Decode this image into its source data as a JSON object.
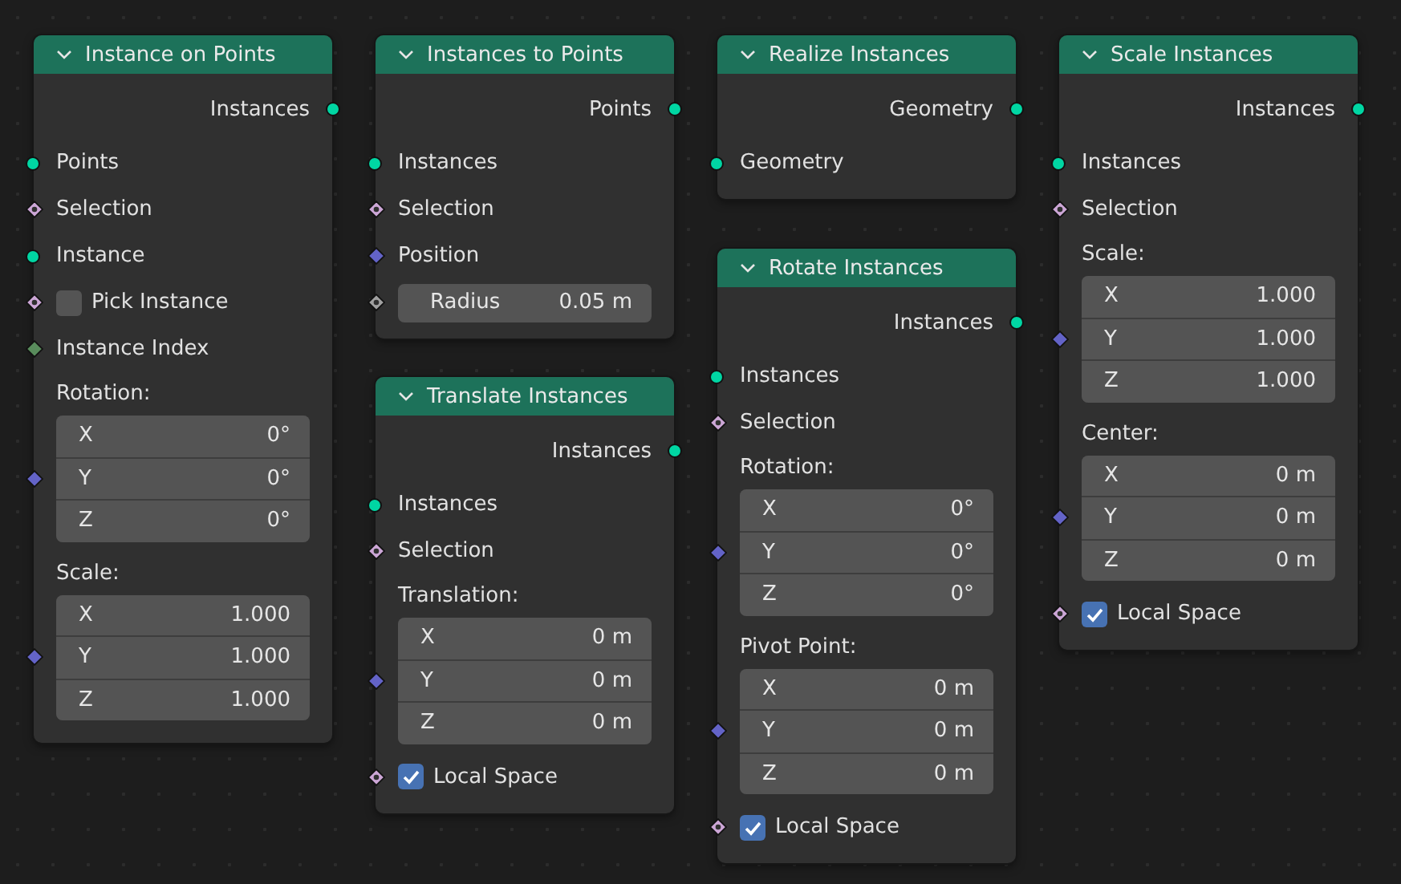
{
  "nodes": [
    {
      "title": "Instance on Points",
      "rows": [
        {
          "kind": "output",
          "label": "Instances",
          "socket": {
            "kind": "geometry"
          }
        },
        {
          "kind": "input",
          "label": "Points",
          "socket": {
            "kind": "geometry"
          }
        },
        {
          "kind": "input",
          "label": "Selection",
          "socket": {
            "kind": "bool"
          }
        },
        {
          "kind": "input",
          "label": "Instance",
          "socket": {
            "kind": "geometry"
          }
        },
        {
          "kind": "checkbox",
          "label": "Pick Instance",
          "socket": {
            "kind": "bool"
          },
          "checked": false
        },
        {
          "kind": "input",
          "label": "Instance Index",
          "socket": {
            "kind": "int"
          }
        },
        {
          "kind": "vector",
          "label": "Rotation:",
          "socket": {
            "kind": "vector"
          },
          "values": [
            {
              "axis": "X",
              "value": "0°"
            },
            {
              "axis": "Y",
              "value": "0°"
            },
            {
              "axis": "Z",
              "value": "0°"
            }
          ]
        },
        {
          "kind": "vector",
          "label": "Scale:",
          "socket": {
            "kind": "vector"
          },
          "values": [
            {
              "axis": "X",
              "value": "1.000"
            },
            {
              "axis": "Y",
              "value": "1.000"
            },
            {
              "axis": "Z",
              "value": "1.000"
            }
          ]
        }
      ]
    },
    {
      "title": "Instances to Points",
      "rows": [
        {
          "kind": "output",
          "label": "Points",
          "socket": {
            "kind": "geometry"
          }
        },
        {
          "kind": "input",
          "label": "Instances",
          "socket": {
            "kind": "geometry"
          }
        },
        {
          "kind": "input",
          "label": "Selection",
          "socket": {
            "kind": "bool"
          }
        },
        {
          "kind": "input",
          "label": "Position",
          "socket": {
            "kind": "vector"
          }
        },
        {
          "kind": "value",
          "label": "Radius",
          "value": "0.05 m",
          "socket": {
            "kind": "float"
          }
        }
      ]
    },
    {
      "title": "Realize Instances",
      "rows": [
        {
          "kind": "output",
          "label": "Geometry",
          "socket": {
            "kind": "geometry"
          }
        },
        {
          "kind": "input",
          "label": "Geometry",
          "socket": {
            "kind": "geometry"
          }
        }
      ]
    },
    {
      "title": "Scale Instances",
      "rows": [
        {
          "kind": "output",
          "label": "Instances",
          "socket": {
            "kind": "geometry"
          }
        },
        {
          "kind": "input",
          "label": "Instances",
          "socket": {
            "kind": "geometry"
          }
        },
        {
          "kind": "input",
          "label": "Selection",
          "socket": {
            "kind": "bool"
          }
        },
        {
          "kind": "vector",
          "label": "Scale:",
          "socket": {
            "kind": "vector"
          },
          "values": [
            {
              "axis": "X",
              "value": "1.000"
            },
            {
              "axis": "Y",
              "value": "1.000"
            },
            {
              "axis": "Z",
              "value": "1.000"
            }
          ]
        },
        {
          "kind": "vector",
          "label": "Center:",
          "socket": {
            "kind": "vector"
          },
          "values": [
            {
              "axis": "X",
              "value": "0 m"
            },
            {
              "axis": "Y",
              "value": "0 m"
            },
            {
              "axis": "Z",
              "value": "0 m"
            }
          ]
        },
        {
          "kind": "checkbox",
          "label": "Local Space",
          "socket": {
            "kind": "bool"
          },
          "checked": true
        }
      ]
    },
    {
      "title": "Translate Instances",
      "rows": [
        {
          "kind": "output",
          "label": "Instances",
          "socket": {
            "kind": "geometry"
          }
        },
        {
          "kind": "input",
          "label": "Instances",
          "socket": {
            "kind": "geometry"
          }
        },
        {
          "kind": "input",
          "label": "Selection",
          "socket": {
            "kind": "bool"
          }
        },
        {
          "kind": "vector",
          "label": "Translation:",
          "socket": {
            "kind": "vector"
          },
          "values": [
            {
              "axis": "X",
              "value": "0 m"
            },
            {
              "axis": "Y",
              "value": "0 m"
            },
            {
              "axis": "Z",
              "value": "0 m"
            }
          ]
        },
        {
          "kind": "checkbox",
          "label": "Local Space",
          "socket": {
            "kind": "bool"
          },
          "checked": true
        }
      ]
    },
    {
      "title": "Rotate Instances",
      "rows": [
        {
          "kind": "output",
          "label": "Instances",
          "socket": {
            "kind": "geometry"
          }
        },
        {
          "kind": "input",
          "label": "Instances",
          "socket": {
            "kind": "geometry"
          }
        },
        {
          "kind": "input",
          "label": "Selection",
          "socket": {
            "kind": "bool"
          }
        },
        {
          "kind": "vector",
          "label": "Rotation:",
          "socket": {
            "kind": "vector"
          },
          "values": [
            {
              "axis": "X",
              "value": "0°"
            },
            {
              "axis": "Y",
              "value": "0°"
            },
            {
              "axis": "Z",
              "value": "0°"
            }
          ]
        },
        {
          "kind": "vector",
          "label": "Pivot Point:",
          "socket": {
            "kind": "vector"
          },
          "values": [
            {
              "axis": "X",
              "value": "0 m"
            },
            {
              "axis": "Y",
              "value": "0 m"
            },
            {
              "axis": "Z",
              "value": "0 m"
            }
          ]
        },
        {
          "kind": "checkbox",
          "label": "Local Space",
          "socket": {
            "kind": "bool"
          },
          "checked": true
        }
      ]
    }
  ]
}
